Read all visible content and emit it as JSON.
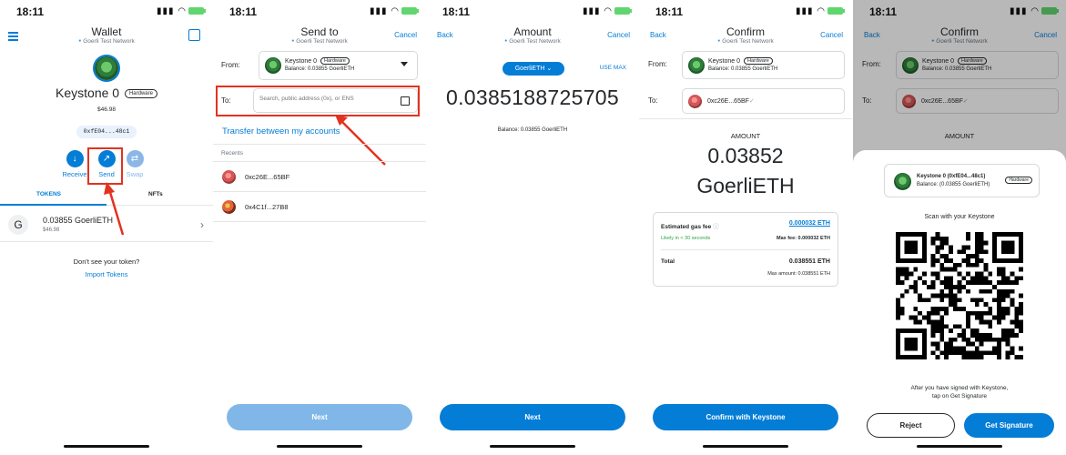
{
  "status": {
    "time": "18:11"
  },
  "colors": {
    "accent": "#037dd6",
    "highlight": "#e3321f",
    "success": "#28a745"
  },
  "screen1": {
    "title": "Wallet",
    "network": "Goerli Test Network",
    "account_name": "Keystone 0",
    "hardware_badge": "Hardware",
    "fiat_balance": "$46.98",
    "address": "0xfE04...48c1",
    "actions": {
      "receive": "Receive",
      "send": "Send",
      "swap": "Swap"
    },
    "tabs": {
      "tokens": "TOKENS",
      "nfts": "NFTs"
    },
    "token": {
      "icon_letter": "G",
      "amount": "0.03855 GoerliETH",
      "fiat": "$46.98"
    },
    "dont_see": "Don't see your token?",
    "import_tokens": "Import Tokens"
  },
  "screen2": {
    "title": "Send to",
    "network": "Goerli Test Network",
    "cancel": "Cancel",
    "from_label": "From:",
    "from_account": "Keystone 0",
    "hardware_badge": "Hardware",
    "from_balance": "Balance: 0.03855 GoerliETH",
    "to_label": "To:",
    "to_placeholder": "Search, public address (0x), or ENS",
    "transfer_link": "Transfer between my accounts",
    "recents_header": "Recents",
    "recents": [
      {
        "address": "0xc26E...65BF"
      },
      {
        "address": "0x4C1f...27B8"
      }
    ],
    "next": "Next"
  },
  "screen3": {
    "back": "Back",
    "title": "Amount",
    "network": "Goerli Test Network",
    "cancel": "Cancel",
    "asset_pill": "GoerliETH",
    "use_max": "USE MAX",
    "amount": "0.0385188725705",
    "balance": "Balance: 0.03855 GoerliETH",
    "next": "Next"
  },
  "screen4": {
    "back": "Back",
    "title": "Confirm",
    "network": "Goerli Test Network",
    "cancel": "Cancel",
    "from_label": "From:",
    "from_account": "Keystone 0",
    "hardware_badge": "Hardware",
    "from_balance": "Balance: 0.03855 GoerliETH",
    "to_label": "To:",
    "to_address": "0xc26E...65BF",
    "amount_label": "AMOUNT",
    "amount_value": "0.03852",
    "amount_unit": "GoerliETH",
    "gas_label": "Estimated gas fee",
    "gas_value": "0.000032 ETH",
    "likely": "Likely in < 30 seconds",
    "max_fee": "Max fee: 0.000032 ETH",
    "total_label": "Total",
    "total_value": "0.038551 ETH",
    "max_amount": "Max amount: 0.038551 ETH",
    "confirm_button": "Confirm with Keystone"
  },
  "screen5": {
    "back": "Back",
    "title": "Confirm",
    "network": "Goerli Test Network",
    "cancel": "Cancel",
    "from_label": "From:",
    "from_account": "Keystone 0",
    "hardware_badge": "Hardware",
    "from_balance": "Balance: 0.03855 GoerliETH",
    "to_label": "To:",
    "to_address": "0xc26E...65BF",
    "amount_label": "AMOUNT",
    "sheet_account": "Keystone 0 (0xfE04...48c1)",
    "sheet_balance": "Balance:  (0.03855 GoerliETH)",
    "sheet_hardware": "Hardware",
    "scan_text": "Scan with your Keystone",
    "after_text_1": "After you have signed with Keystone,",
    "after_text_2": "tap on Get Signature",
    "reject": "Reject",
    "get_signature": "Get Signature"
  }
}
